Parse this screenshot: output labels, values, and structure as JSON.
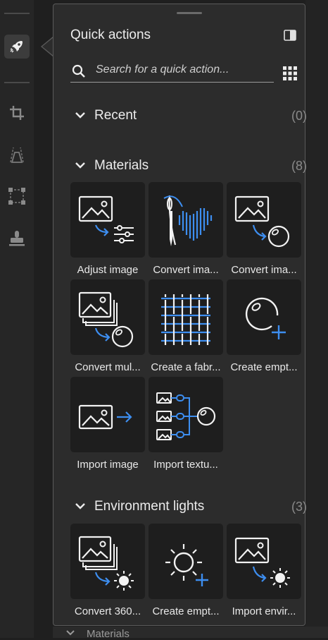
{
  "panel": {
    "title": "Quick actions",
    "search_placeholder": "Search for a quick action..."
  },
  "sections": [
    {
      "label": "Recent",
      "count": "(0)",
      "items": []
    },
    {
      "label": "Materials",
      "count": "(8)",
      "items": [
        {
          "label": "Adjust image",
          "icon": "adjust-image-icon"
        },
        {
          "label": "Convert ima...",
          "icon": "convert-image-fabric-icon"
        },
        {
          "label": "Convert ima...",
          "icon": "convert-image-material-icon"
        },
        {
          "label": "Convert mul...",
          "icon": "convert-multiple-images-icon"
        },
        {
          "label": "Create a fabr...",
          "icon": "fabric-weave-icon"
        },
        {
          "label": "Create empt...",
          "icon": "create-empty-material-icon"
        },
        {
          "label": "Import image",
          "icon": "import-image-icon"
        },
        {
          "label": "Import textu...",
          "icon": "import-textures-icon"
        }
      ]
    },
    {
      "label": "Environment lights",
      "count": "(3)",
      "items": [
        {
          "label": "Convert 360...",
          "icon": "convert-360-icon"
        },
        {
          "label": "Create empt...",
          "icon": "create-empty-light-icon"
        },
        {
          "label": "Import envir...",
          "icon": "import-environment-icon"
        }
      ]
    }
  ],
  "background": {
    "obscured_section_label": "Materials"
  },
  "colors": {
    "accent": "#3d8ef0",
    "panel_bg": "#2c2c2c",
    "tile_bg": "#1e1e1e"
  }
}
